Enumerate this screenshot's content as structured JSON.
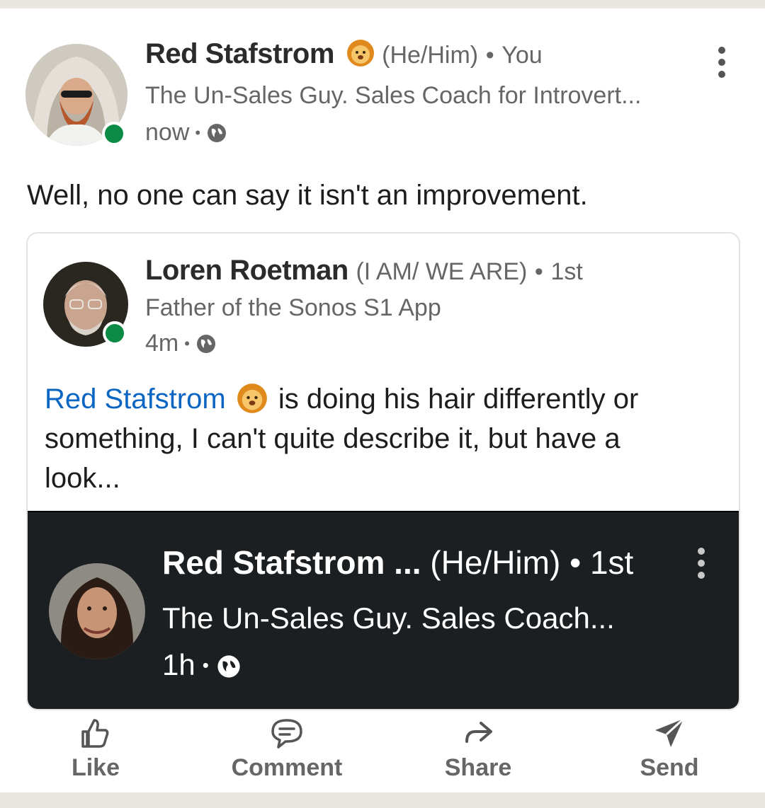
{
  "post": {
    "author": {
      "name": "Red Stafstrom",
      "badge_icon": "lion-emoji",
      "pronouns": "(He/Him)",
      "relationship": "You",
      "headline": "The Un-Sales Guy. Sales Coach for Introvert...",
      "time": "now",
      "visibility_icon": "globe-icon"
    },
    "commentary": "Well, no one can say it isn't an improvement.",
    "shared": {
      "author": {
        "name": "Loren Roetman",
        "tagline": "(I AM/ WE ARE)",
        "relationship": "1st",
        "headline": "Father of the Sonos S1 App",
        "time": "4m"
      },
      "text": {
        "mention": "Red Stafstrom",
        "rest": " is doing his hair differently or something, I can't quite describe it, but have a look..."
      },
      "embedded": {
        "name": "Red Stafstrom ...",
        "pronouns": "(He/Him)",
        "relationship": "1st",
        "headline": "The Un-Sales Guy. Sales Coach...",
        "time": "1h"
      }
    }
  },
  "actions": [
    {
      "label": "Like",
      "icon": "thumbs-up-icon"
    },
    {
      "label": "Comment",
      "icon": "comment-icon"
    },
    {
      "label": "Share",
      "icon": "share-arrow-icon"
    },
    {
      "label": "Send",
      "icon": "send-icon"
    }
  ],
  "colors": {
    "link": "#0a66c2",
    "online": "#0b8b45",
    "dark_panel": "#1b1f21"
  }
}
